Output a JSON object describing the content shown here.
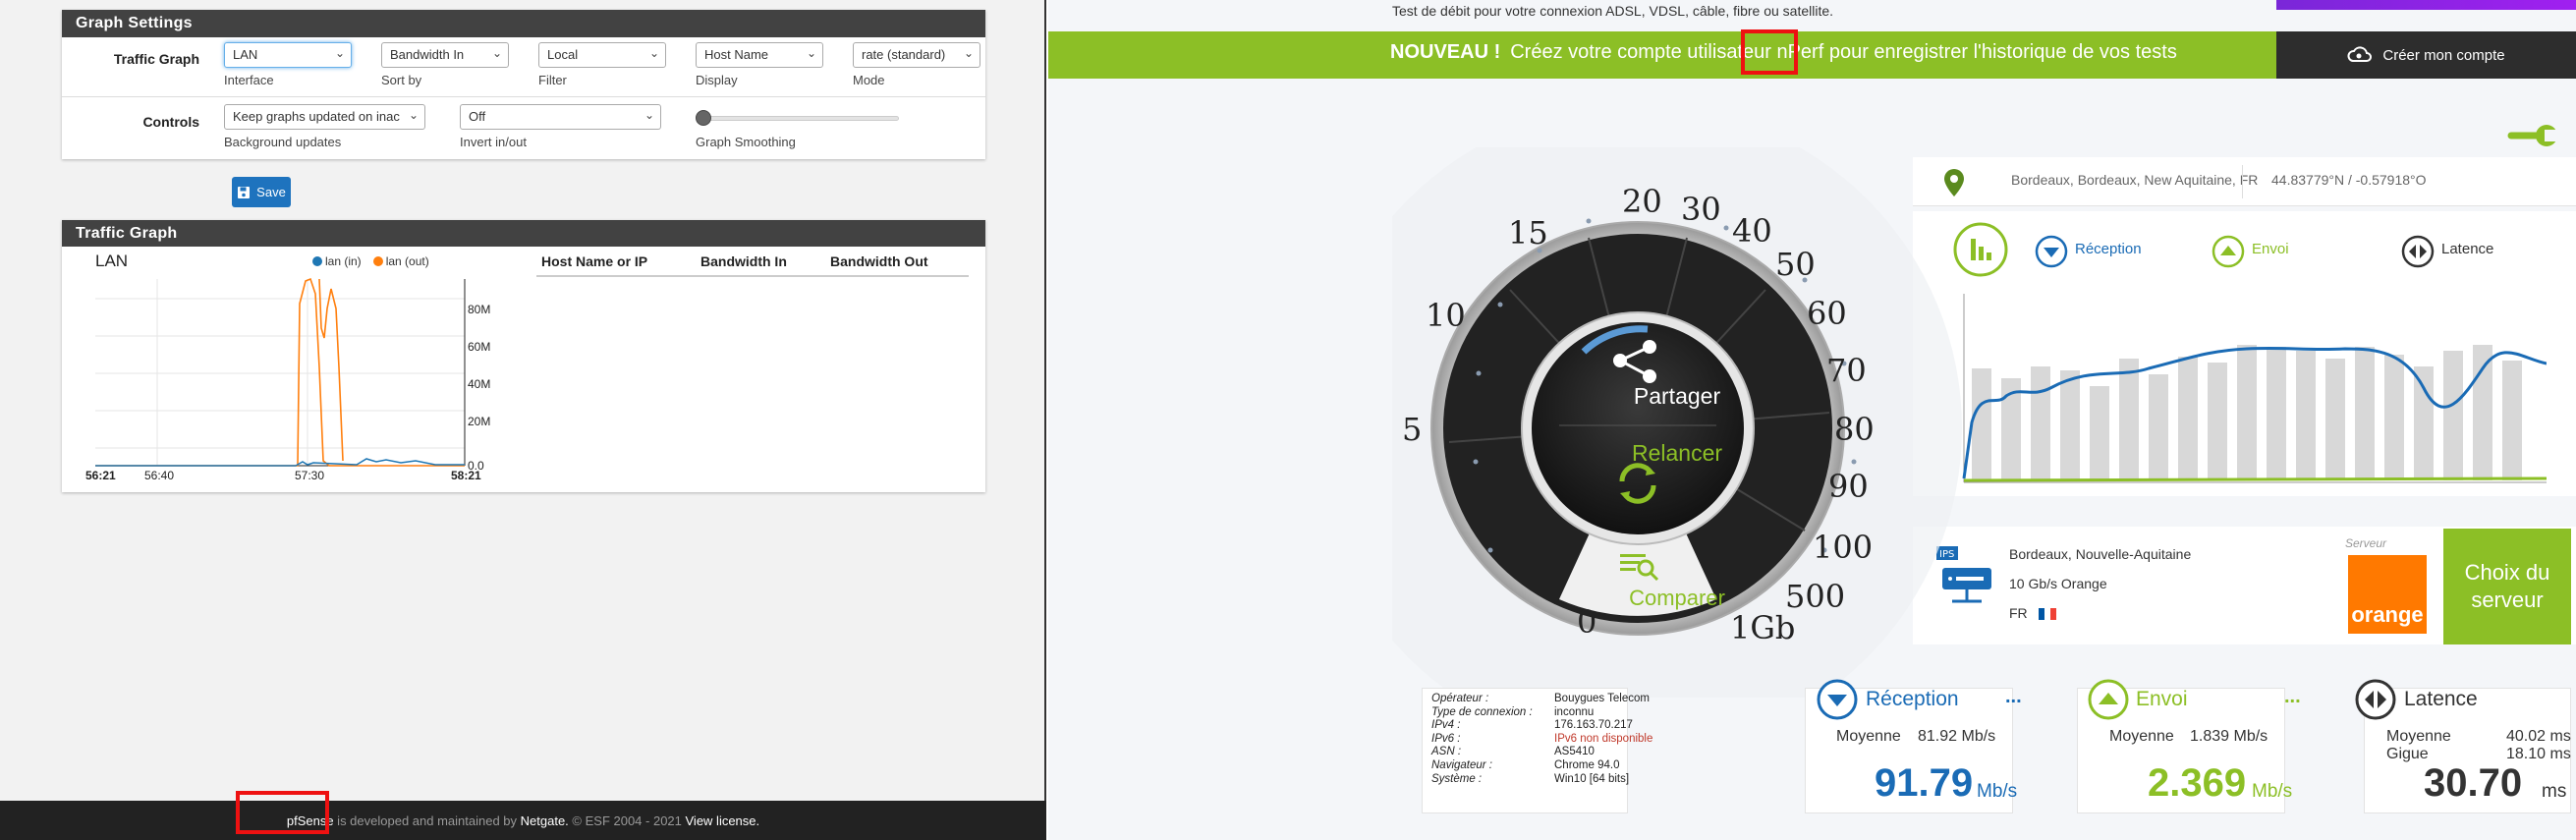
{
  "pfsense": {
    "settings": {
      "title": "Graph Settings",
      "traffic_graph_label": "Traffic Graph",
      "controls_label": "Controls",
      "interface": {
        "value": "LAN",
        "caption": "Interface"
      },
      "sort_by": {
        "value": "Bandwidth In",
        "caption": "Sort by"
      },
      "filter": {
        "value": "Local",
        "caption": "Filter"
      },
      "display": {
        "value": "Host Name",
        "caption": "Display"
      },
      "mode": {
        "value": "rate (standard)",
        "caption": "Mode"
      },
      "background_updates": {
        "value": "Keep graphs updated on inac",
        "caption": "Background updates"
      },
      "invert": {
        "value": "Off",
        "caption": "Invert in/out"
      },
      "smoothing": {
        "caption": "Graph Smoothing",
        "level": 0
      },
      "save_label": "Save"
    },
    "traffic": {
      "title": "Traffic Graph",
      "graph_title": "LAN",
      "legend": [
        {
          "label": "lan (in)",
          "color": "#1f77b4"
        },
        {
          "label": "lan (out)",
          "color": "#ff7f0e"
        }
      ],
      "y_ticks": [
        "80M",
        "60M",
        "40M",
        "20M",
        "0.0"
      ],
      "x_ticks": [
        "56:21",
        "56:40",
        "57:30",
        "58:21"
      ],
      "columns": [
        "Host Name or IP",
        "Bandwidth In",
        "Bandwidth Out"
      ]
    },
    "footer": {
      "brand": "pfSense",
      "text1": " is developed and maintained by ",
      "netgate": "Netgate.",
      "text2": " © ESF 2004 - 2021 ",
      "license": "View license."
    }
  },
  "nperf": {
    "top_text": "Test de débit pour votre connexion ADSL, VDSL, câble, fibre ou satellite.",
    "banner": {
      "new": "NOUVEAU !",
      "text_before": "Créez votre compte utilisateur ",
      "brand": "nPerf",
      "text_after": " pour enregistrer l'historique de vos tests",
      "account_button": "Créer mon compte"
    },
    "location": {
      "city": "Bordeaux, Bordeaux, New Aquitaine, FR",
      "coords": "44.83779°N / -0.57918°O"
    },
    "legend": {
      "reception": "Réception",
      "envoi": "Envoi",
      "latence": "Latence"
    },
    "dial": {
      "labels": [
        "0",
        "5",
        "10",
        "15",
        "20",
        "30",
        "40",
        "50",
        "60",
        "70",
        "80",
        "90",
        "100",
        "500",
        "1Gb"
      ],
      "share": "Partager",
      "relancer": "Relancer",
      "comparer": "Comparer"
    },
    "server": {
      "badge": "IPS",
      "city": "Bordeaux, Nouvelle-Aquitaine",
      "name": "10 Gb/s Orange",
      "country": "FR",
      "label": "Serveur",
      "logo": "orange",
      "choose": "Choix du serveur"
    },
    "info": [
      {
        "k": "Opérateur :",
        "v": "Bouygues Telecom"
      },
      {
        "k": "Type de connexion :",
        "v": "inconnu"
      },
      {
        "k": "IPv4 :",
        "v": "176.163.70.217"
      },
      {
        "k": "IPv6 :",
        "v": "IPv6 non disponible"
      },
      {
        "k": "ASN :",
        "v": "AS5410"
      },
      {
        "k": "Navigateur :",
        "v": "Chrome 94.0"
      },
      {
        "k": "Système :",
        "v": "Win10 [64 bits]"
      }
    ],
    "reception": {
      "title": "Réception",
      "more": "...",
      "avg_label": "Moyenne",
      "avg": "81.92 Mb/s",
      "value": "91.79",
      "unit": "Mb/s"
    },
    "envoi": {
      "title": "Envoi",
      "more": "...",
      "avg_label": "Moyenne",
      "avg": "1.839 Mb/s",
      "value": "2.369",
      "unit": "Mb/s"
    },
    "latence": {
      "title": "Latence",
      "avg_label": "Moyenne",
      "avg": "40.02 ms",
      "jitter_label": "Gigue",
      "jitter": "18.10 ms",
      "value": "30.70",
      "unit": "ms"
    }
  },
  "colors": {
    "pf_header": "#424242",
    "pf_blue": "#1e73be",
    "nperf_green": "#8cbf26",
    "nperf_blue": "#1a6bb5",
    "orange": "#ff7900",
    "highlight": "#e11111"
  }
}
